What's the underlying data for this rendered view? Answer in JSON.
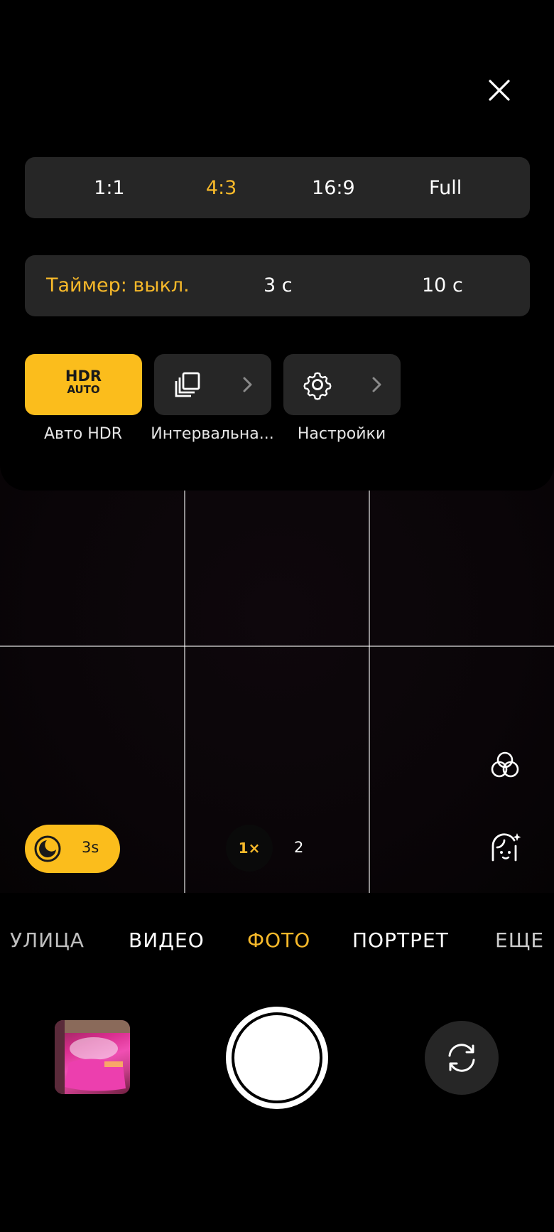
{
  "status": {
    "indicator_color": "#1fc43a"
  },
  "colors": {
    "accent": "#f7b92a",
    "panel": "#262626",
    "hdr_tile": "#fbbd1c"
  },
  "aspect_ratio": {
    "options": [
      "1:1",
      "4:3",
      "16:9",
      "Full"
    ],
    "selected": "4:3"
  },
  "timer": {
    "options": [
      "Таймер: выкл.",
      "3 с",
      "10 с"
    ],
    "selected": "Таймер: выкл."
  },
  "quick_tiles": [
    {
      "icon": "hdr-auto-icon",
      "label": "Авто HDR",
      "icon_text_1": "HDR",
      "icon_text_2": "AUTO",
      "active": true
    },
    {
      "icon": "burst-icon",
      "label": "Интервальна...",
      "active": false
    },
    {
      "icon": "gear-icon",
      "label": "Настройки",
      "active": false
    }
  ],
  "night_mode": {
    "icon": "moon-icon",
    "value": "3s"
  },
  "zoom": {
    "active": "1×",
    "other": "2"
  },
  "side_icons": [
    "filters-icon",
    "beauty-icon"
  ],
  "modes": {
    "items": [
      "УЛИЦА",
      "ВИДЕО",
      "ФОТО",
      "ПОРТРЕТ",
      "ЕЩЕ"
    ],
    "selected": "ФОТО"
  },
  "controls": {
    "gallery": "gallery-thumbnail",
    "shutter": "shutter-button",
    "flip": "flip-camera-icon"
  }
}
